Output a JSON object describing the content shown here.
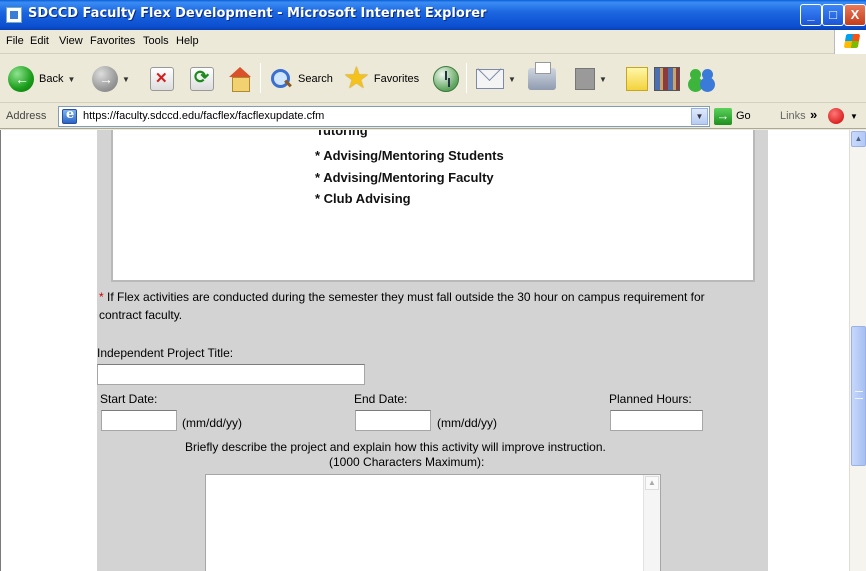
{
  "window": {
    "title": "SDCCD Faculty Flex Development - Microsoft Internet Explorer",
    "minimize": "_",
    "maximize": "□",
    "close": "X"
  },
  "menu": [
    "File",
    "Edit",
    "View",
    "Favorites",
    "Tools",
    "Help"
  ],
  "toolbar": {
    "back_label": "Back",
    "search_label": "Search",
    "favorites_label": "Favorites"
  },
  "address": {
    "label": "Address",
    "url": "https://faculty.sdccd.edu/facflex/facflexupdate.cfm",
    "go_label": "Go",
    "links_label": "Links"
  },
  "list": {
    "partial_item": "Tutoring",
    "items": [
      "* Advising/Mentoring Students",
      "* Advising/Mentoring Faculty",
      "* Club Advising"
    ]
  },
  "note": {
    "asterisk": "*",
    "text": "If Flex activities are conducted during the semester they must fall outside the 30 hour on campus requirement for contract faculty."
  },
  "form": {
    "project_title_label": "Independent Project Title:",
    "project_title_value": "",
    "start_date_label": "Start Date:",
    "start_date_value": "",
    "end_date_label": "End Date:",
    "end_date_value": "",
    "date_hint": "(mm/dd/yy)",
    "planned_hours_label": "Planned Hours:",
    "planned_hours_value": "",
    "describe_label": "Briefly describe the project and explain how this activity will improve instruction.",
    "describe_limit": "(1000 Characters Maximum):",
    "describe_value": ""
  }
}
